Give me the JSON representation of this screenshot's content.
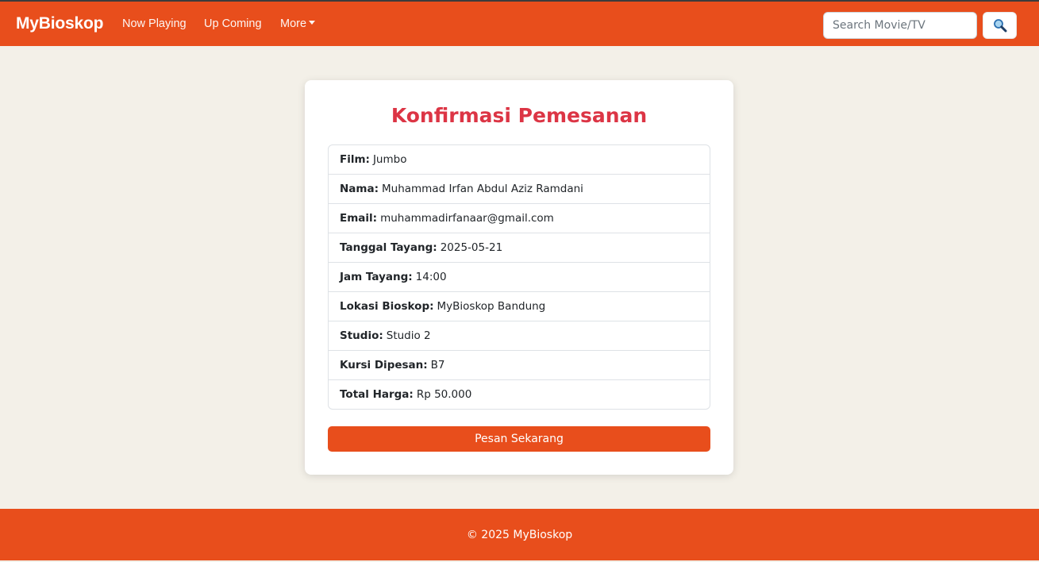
{
  "colors": {
    "primary": "#e84e1c",
    "title_red": "#dc3545",
    "background": "#f3f0e8"
  },
  "navbar": {
    "brand": "MyBioskop",
    "links": [
      "Now Playing",
      "Up Coming",
      "More"
    ],
    "search_placeholder": "Search Movie/TV",
    "search_icon": "magnifier-icon"
  },
  "card": {
    "title": "Konfirmasi Pemesanan",
    "items": [
      {
        "label": "Film:",
        "value": "Jumbo"
      },
      {
        "label": "Nama:",
        "value": "Muhammad Irfan Abdul Aziz Ramdani"
      },
      {
        "label": "Email:",
        "value": "muhammadirfanaar@gmail.com"
      },
      {
        "label": "Tanggal Tayang:",
        "value": "2025-05-21"
      },
      {
        "label": "Jam Tayang:",
        "value": "14:00"
      },
      {
        "label": "Lokasi Bioskop:",
        "value": "MyBioskop Bandung"
      },
      {
        "label": "Studio:",
        "value": "Studio 2"
      },
      {
        "label": "Kursi Dipesan:",
        "value": "B7"
      },
      {
        "label": "Total Harga:",
        "value": "Rp 50.000"
      }
    ],
    "button": "Pesan Sekarang"
  },
  "footer": {
    "text": "© 2025 MyBioskop"
  }
}
